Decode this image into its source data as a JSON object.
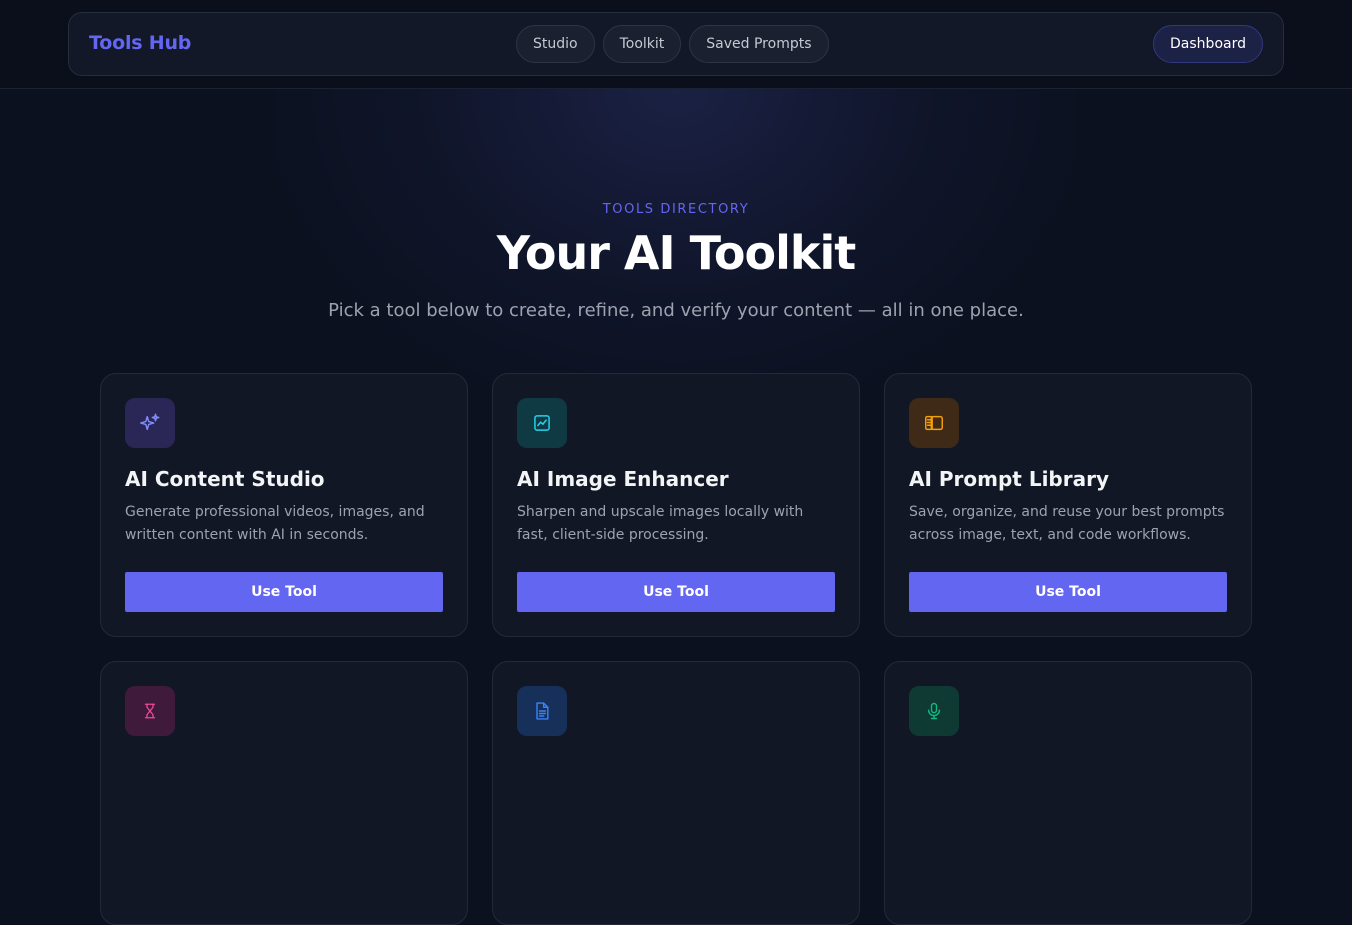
{
  "navbar": {
    "brand": "Tools Hub",
    "links": [
      {
        "label": "Studio"
      },
      {
        "label": "Toolkit"
      },
      {
        "label": "Saved Prompts"
      }
    ],
    "dashboard_label": "Dashboard"
  },
  "hero": {
    "eyebrow": "TOOLS DIRECTORY",
    "title": "Your AI Toolkit",
    "subtitle": "Pick a tool below to create, refine, and verify your content — all in one place."
  },
  "tools": [
    {
      "title": "AI Content Studio",
      "description": "Generate professional videos, images, and written content with AI in seconds.",
      "button": "Use Tool",
      "icon": "sparkles-icon",
      "icon_color": "#818cf8",
      "icon_bg": "#2a2655"
    },
    {
      "title": "AI Image Enhancer",
      "description": "Sharpen and upscale images locally with fast, client-side processing.",
      "button": "Use Tool",
      "icon": "image-chart-icon",
      "icon_color": "#22d3ee",
      "icon_bg": "#0f3a44"
    },
    {
      "title": "AI Prompt Library",
      "description": "Save, organize, and reuse your best prompts across image, text, and code workflows.",
      "button": "Use Tool",
      "icon": "library-icon",
      "icon_color": "#f59e0b",
      "icon_bg": "#3f2a17"
    },
    {
      "title": "",
      "description": "",
      "button": "",
      "icon": "hourglass-icon",
      "icon_color": "#ec4899",
      "icon_bg": "#3f1a3a"
    },
    {
      "title": "",
      "description": "",
      "button": "",
      "icon": "document-icon",
      "icon_color": "#3b82f6",
      "icon_bg": "#16305a"
    },
    {
      "title": "",
      "description": "",
      "button": "",
      "icon": "microphone-icon",
      "icon_color": "#10b981",
      "icon_bg": "#0f3a34"
    }
  ]
}
